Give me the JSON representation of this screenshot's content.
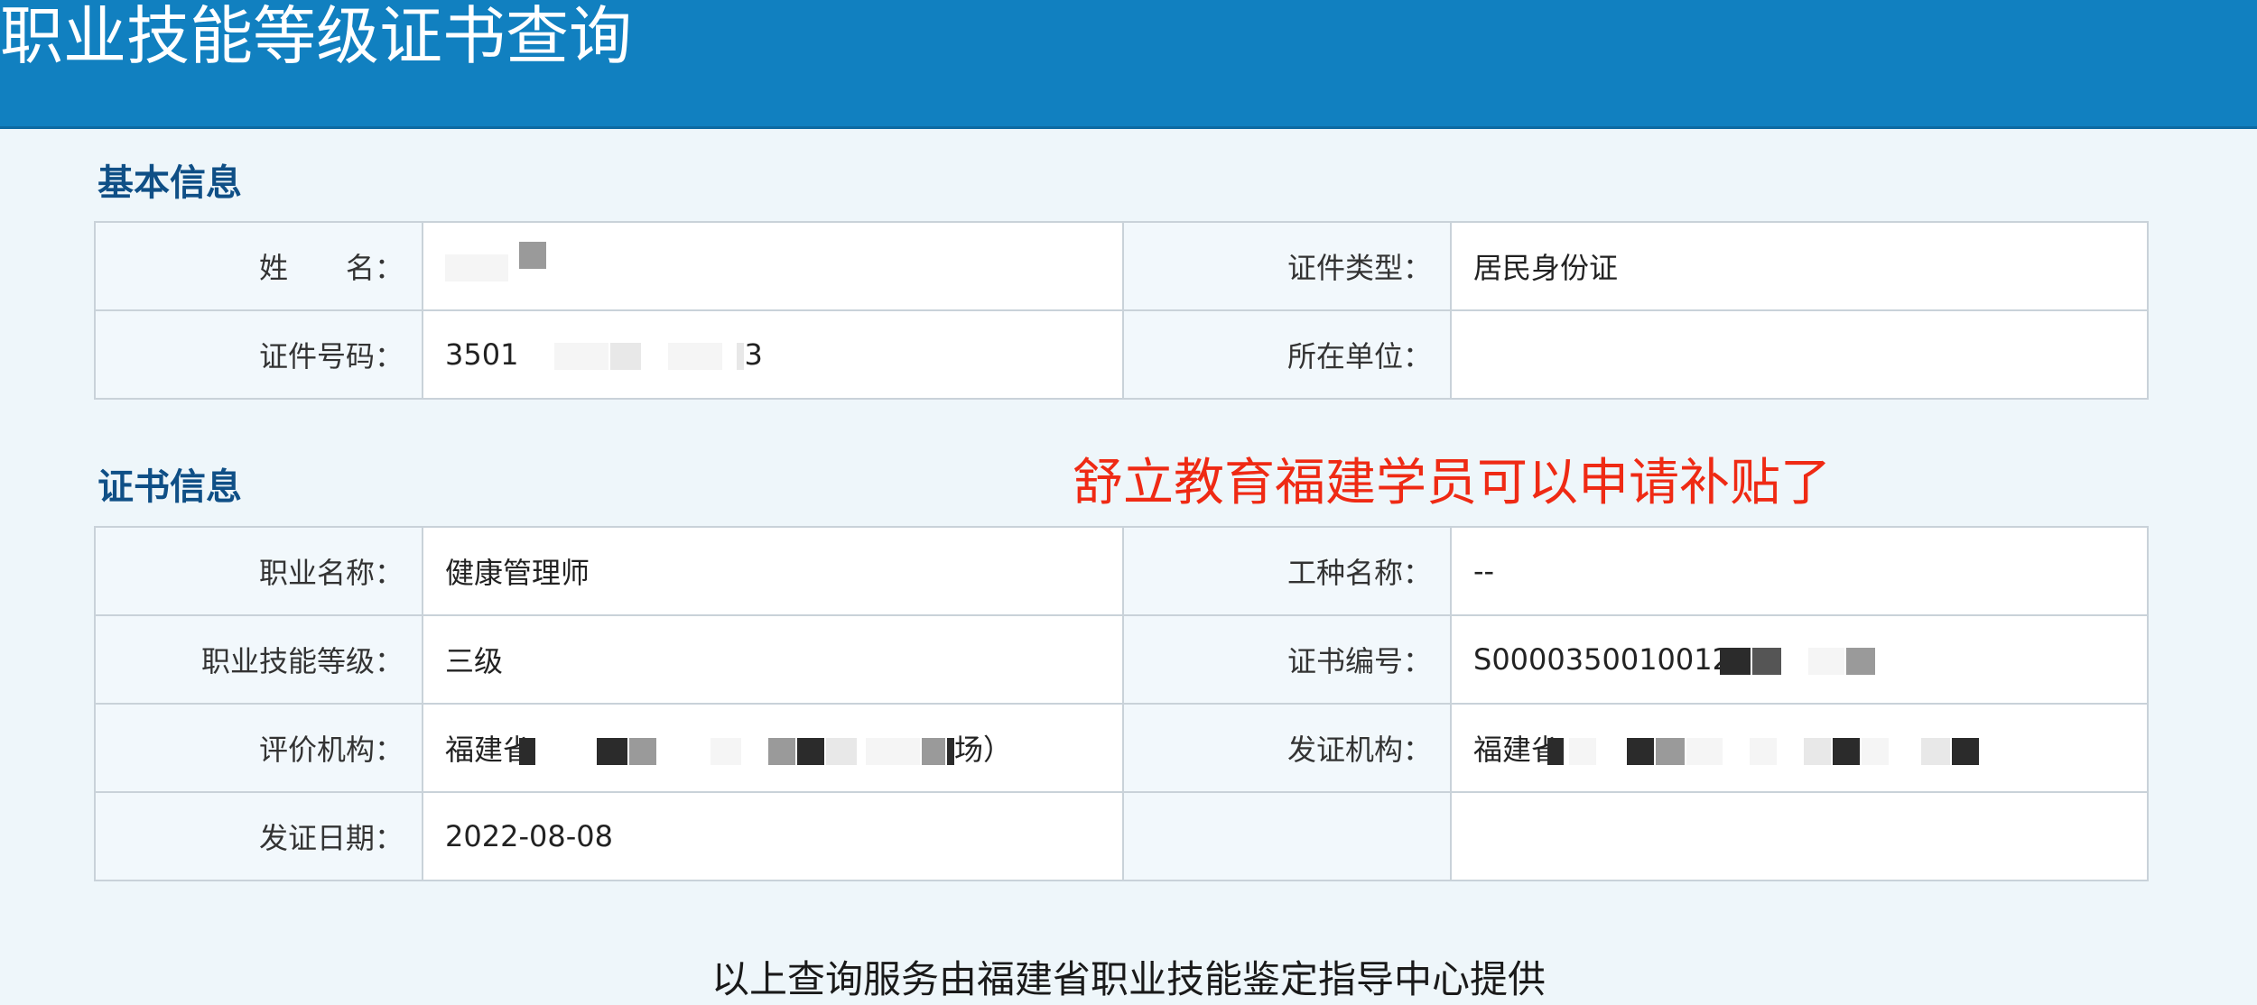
{
  "header": {
    "title": "职业技能等级证书查询"
  },
  "basic_info": {
    "section_title": "基本信息",
    "name_label": "姓　　名：",
    "name_value": "",
    "id_type_label": "证件类型：",
    "id_type_value": "居民身份证",
    "id_number_label": "证件号码：",
    "id_number_prefix": "3501",
    "id_number_suffix": "3",
    "employer_label": "所在单位：",
    "employer_value": ""
  },
  "cert_info": {
    "section_title": "证书信息",
    "occupation_label": "职业名称：",
    "occupation_value": "健康管理师",
    "job_type_label": "工种名称：",
    "job_type_value": "--",
    "level_label": "职业技能等级：",
    "level_value": "三级",
    "cert_number_label": "证书编号：",
    "cert_number_value": "S0000350010012",
    "evaluator_label": "评价机构：",
    "evaluator_prefix": "福建省",
    "evaluator_suffix": "场）",
    "issuer_label": "发证机构：",
    "issuer_prefix": "福建省",
    "issue_date_label": "发证日期：",
    "issue_date_value": "2022-08-08"
  },
  "annotation": {
    "text": "舒立教育福建学员可以申请补贴了",
    "color": "#ef2a14"
  },
  "footer": {
    "text": "以上查询服务由福建省职业技能鉴定指导中心提供"
  },
  "colors": {
    "header_bg": "#1180c0",
    "section_title": "#0f4f86",
    "page_bg": "#eef6fa",
    "label_cell_bg": "#f2f8fc",
    "border": "#c9d2d9"
  }
}
